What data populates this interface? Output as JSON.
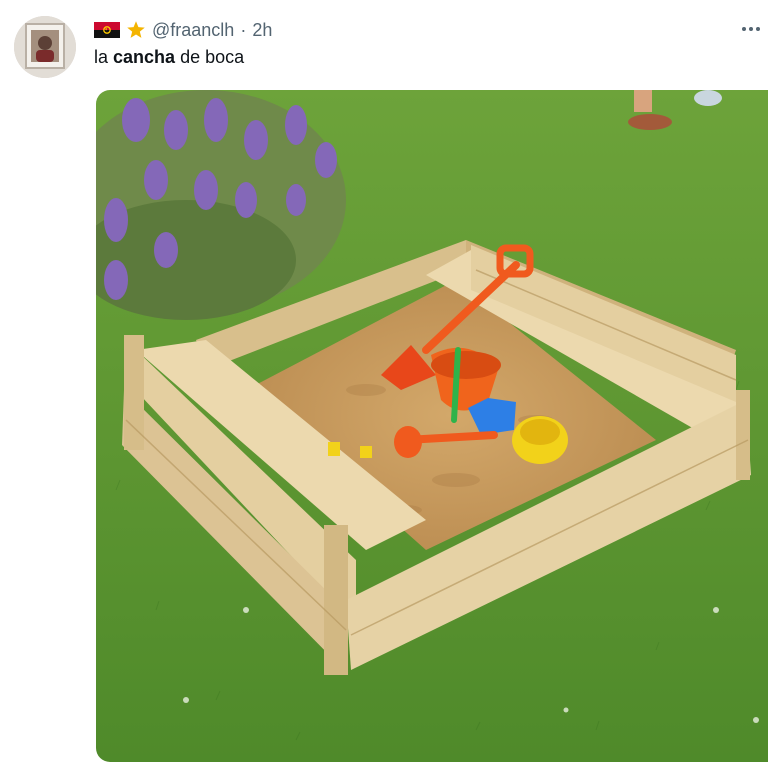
{
  "tweet": {
    "handle": "@fraanclh",
    "separator": "·",
    "time": "2h",
    "text_before": "la ",
    "text_bold": "cancha",
    "text_after": " de boca"
  },
  "icons": {
    "avatar": "user-avatar",
    "flag": "angola-flag-icon",
    "star": "star-icon",
    "more": "more-dots-icon"
  },
  "colors": {
    "grass": "#5f9a32",
    "wood": "#e4cfa0",
    "sand": "#c89a5e",
    "lavender": "#8468b8",
    "shovel": "#f05a1e",
    "yellow_toy": "#f2d21a",
    "blue_toy": "#2d7fe6"
  },
  "media": {
    "alt": ""
  }
}
